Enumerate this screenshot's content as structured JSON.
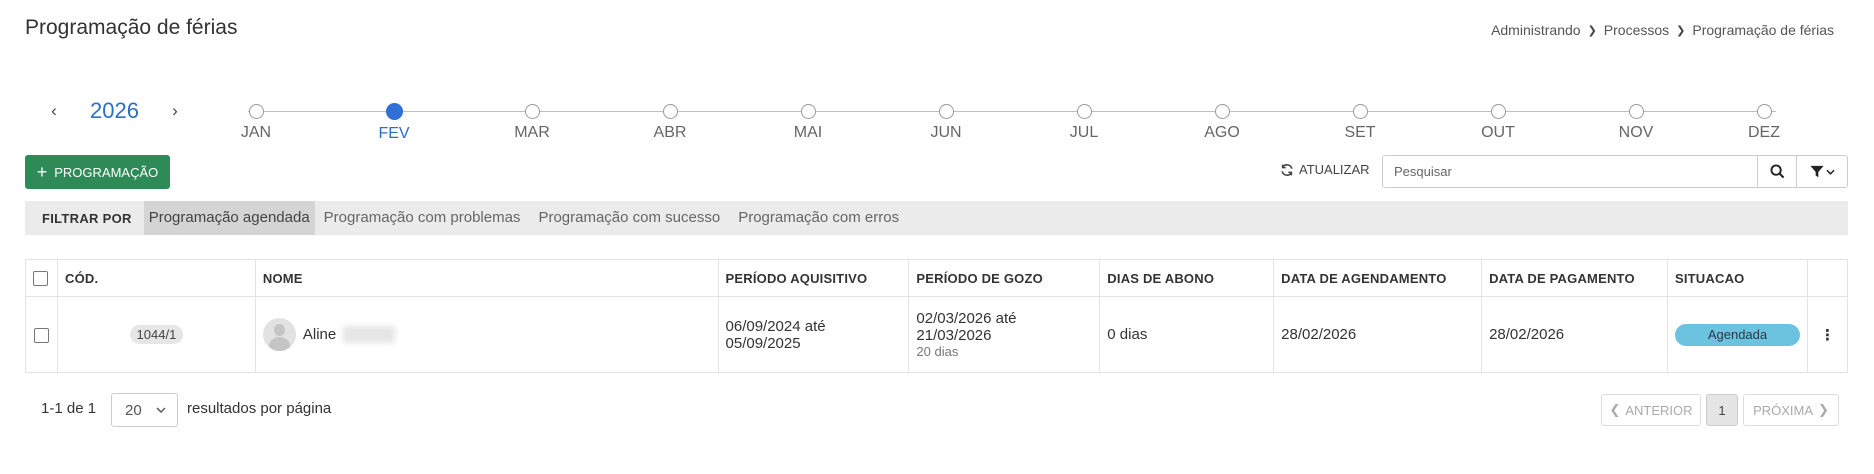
{
  "page": {
    "title": "Programação de férias"
  },
  "breadcrumb": [
    "Administrando",
    "Processos",
    "Programação de férias"
  ],
  "year_nav": {
    "year": "2026",
    "prev_icon": "chevron-left-icon",
    "next_icon": "chevron-right-icon"
  },
  "months": [
    {
      "label": "JAN",
      "active": false
    },
    {
      "label": "FEV",
      "active": true
    },
    {
      "label": "MAR",
      "active": false
    },
    {
      "label": "ABR",
      "active": false
    },
    {
      "label": "MAI",
      "active": false
    },
    {
      "label": "JUN",
      "active": false
    },
    {
      "label": "JUL",
      "active": false
    },
    {
      "label": "AGO",
      "active": false
    },
    {
      "label": "SET",
      "active": false
    },
    {
      "label": "OUT",
      "active": false
    },
    {
      "label": "NOV",
      "active": false
    },
    {
      "label": "DEZ",
      "active": false
    }
  ],
  "toolbar": {
    "add_label": "PROGRAMAÇÃO",
    "refresh_label": "ATUALIZAR",
    "search_placeholder": "Pesquisar"
  },
  "filter_bar": {
    "label": "FILTRAR POR",
    "chips": [
      {
        "label": "Programação agendada",
        "active": true
      },
      {
        "label": "Programação com problemas",
        "active": false
      },
      {
        "label": "Programação com sucesso",
        "active": false
      },
      {
        "label": "Programação com erros",
        "active": false
      }
    ]
  },
  "table": {
    "headers": {
      "code": "CÓD.",
      "name": "NOME",
      "acquisition": "PERÍODO AQUISITIVO",
      "enjoyment": "PERÍODO DE GOZO",
      "bonus_days": "DIAS DE ABONO",
      "schedule_date": "DATA DE AGENDAMENTO",
      "payment_date": "DATA DE PAGAMENTO",
      "status": "SITUACAO"
    },
    "rows": [
      {
        "code": "1044/1",
        "name": "Aline",
        "acquisition_line1": "06/09/2024 até",
        "acquisition_line2": "05/09/2025",
        "enjoyment_line1": "02/03/2026 até",
        "enjoyment_line2": "21/03/2026",
        "enjoyment_days": "20 dias",
        "bonus_days": "0 dias",
        "schedule_date": "28/02/2026",
        "payment_date": "28/02/2026",
        "status": "Agendada",
        "status_color": "#6cc3e0"
      }
    ]
  },
  "footer": {
    "range": "1-1 de 1",
    "per_page": "20",
    "per_page_label": "resultados por página",
    "prev_label": "ANTERIOR",
    "current_page": "1",
    "next_label": "PRÓXIMA"
  },
  "colors": {
    "primary_button": "#2e8b57",
    "accent_blue": "#2d6ec8"
  }
}
